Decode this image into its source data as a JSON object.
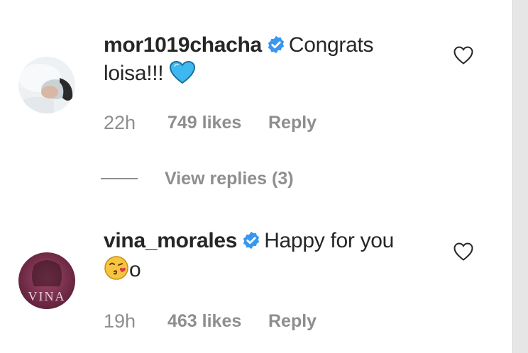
{
  "comments": [
    {
      "username": "mor1019chacha",
      "text": "Congrats loisa!!!",
      "emoji_icon": "blue-heart-emoji-icon",
      "time": "22h",
      "likes": "749 likes",
      "reply_label": "Reply"
    },
    {
      "username": "vina_morales",
      "text": "Happy for you",
      "emoji_icon": "face-blowing-kiss-emoji-icon",
      "text_after_emoji": "o",
      "time": "19h",
      "likes": "463 likes",
      "reply_label": "Reply"
    }
  ],
  "view_replies_label": "View replies (3)",
  "colors": {
    "text": "#262626",
    "secondary": "#8e8e8e",
    "verified": "#3897f0",
    "blue_heart": "#3fb8ef"
  }
}
